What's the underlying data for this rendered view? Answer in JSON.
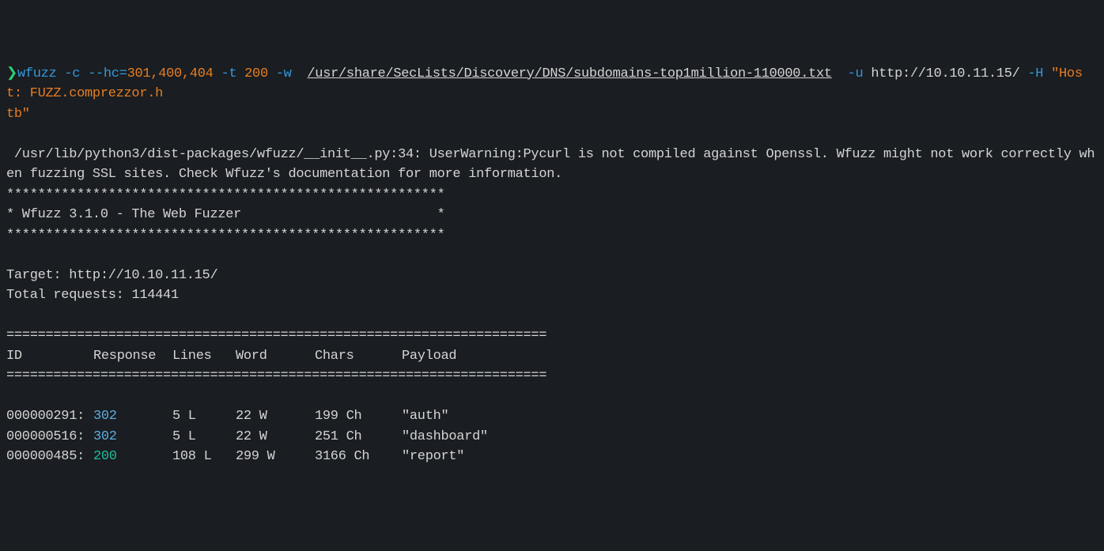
{
  "command": {
    "prompt": "❯",
    "tool": "wfuzz",
    "flag1": "-c",
    "flag2": "--hc=",
    "hc_codes": "301,400,404",
    "flag3": "-t",
    "threads": "200",
    "flag4": "-w",
    "wordlist": "/usr/share/SecLists/Discovery/DNS/subdomains-top1million-110000.txt",
    "flag5": "-u",
    "url": "http://10.10.11.15/",
    "flag6": "-H",
    "header_part1": "\"Host: FUZZ.comprezzor.h",
    "header_part2": "tb\""
  },
  "warning": " /usr/lib/python3/dist-packages/wfuzz/__init__.py:34: UserWarning:Pycurl is not compiled against Openssl. Wfuzz might not work correctly when fuzzing SSL sites. Check Wfuzz's documentation for more information.",
  "banner": {
    "stars1": "********************************************************",
    "title": "* Wfuzz 3.1.0 - The Web Fuzzer                         *",
    "stars2": "********************************************************"
  },
  "target_label": "Target: ",
  "target_url": "http://10.10.11.15/",
  "total_requests_label": "Total requests: ",
  "total_requests": "114441",
  "divider": "=====================================================================",
  "headers": {
    "id": "ID",
    "response": "Response",
    "lines": "Lines",
    "word": "Word",
    "chars": "Chars",
    "payload": "Payload"
  },
  "results": [
    {
      "id": "000000291:",
      "response": "302",
      "resp_class": "code-302",
      "lines": "5 L",
      "word": "22 W",
      "chars": "199 Ch",
      "payload": "\"auth\""
    },
    {
      "id": "000000516:",
      "response": "302",
      "resp_class": "code-302",
      "lines": "5 L",
      "word": "22 W",
      "chars": "251 Ch",
      "payload": "\"dashboard\""
    },
    {
      "id": "000000485:",
      "response": "200",
      "resp_class": "code-200",
      "lines": "108 L",
      "word": "299 W",
      "chars": "3166 Ch",
      "payload": "\"report\""
    }
  ]
}
